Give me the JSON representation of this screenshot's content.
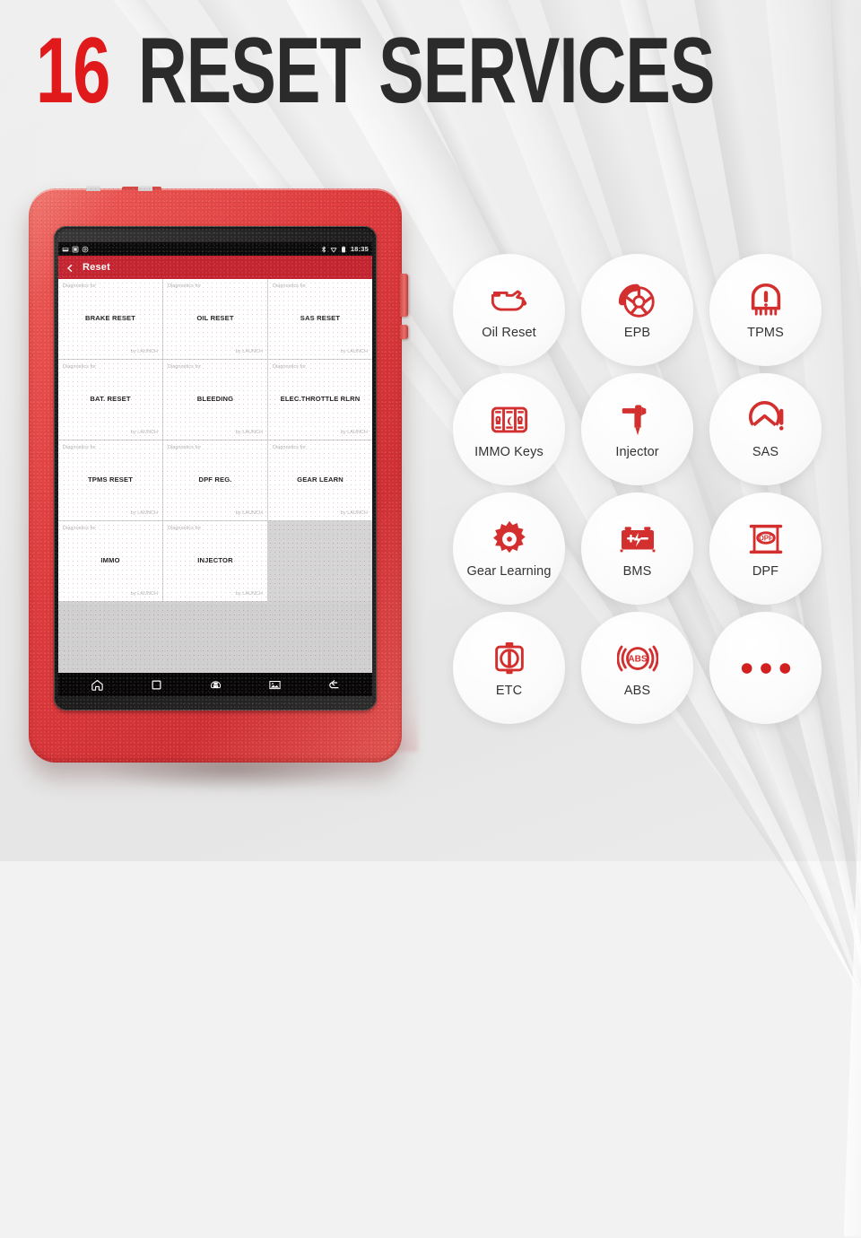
{
  "headline": {
    "number": "16",
    "text": "RESET SERVICES",
    "number_color": "#e0191b",
    "text_color": "#2b2b2b"
  },
  "device": {
    "name": "launch-diagnostic-tablet",
    "case_color": "#d9383b",
    "bezel_color": "#1a1a1a"
  },
  "status_bar": {
    "clock": "18:35",
    "left_icons": [
      "sdcard-icon",
      "screenshot-icon",
      "settings-icon"
    ],
    "right_icons": [
      "bluetooth-icon",
      "wifi-icon",
      "battery-icon"
    ]
  },
  "app_header": {
    "back_icon": "chevron-left-icon",
    "title": "Reset",
    "color": "#c3242f"
  },
  "reset_grid": {
    "subtitle_label": "Diagnostics for",
    "vendor_label": "by LAUNCH",
    "items": [
      {
        "title": "BRAKE RESET"
      },
      {
        "title": "OIL RESET"
      },
      {
        "title": "SAS RESET"
      },
      {
        "title": "BAT. RESET"
      },
      {
        "title": "BLEEDING"
      },
      {
        "title": "ELEC.THROTTLE RLRN"
      },
      {
        "title": "TPMS RESET"
      },
      {
        "title": "DPF REG."
      },
      {
        "title": "GEAR LEARN"
      },
      {
        "title": "IMMO"
      },
      {
        "title": "INJECTOR"
      }
    ]
  },
  "nav_bar": {
    "buttons": [
      {
        "name": "home-icon"
      },
      {
        "name": "recents-square-icon"
      },
      {
        "name": "vci-connector-icon"
      },
      {
        "name": "screenshot-image-icon"
      },
      {
        "name": "back-arrow-icon"
      }
    ]
  },
  "features": {
    "accent_color": "#d32f2f",
    "items": [
      {
        "label": "Oil Reset",
        "icon": "oil-can-icon"
      },
      {
        "label": "EPB",
        "icon": "brake-wheel-icon"
      },
      {
        "label": "TPMS",
        "icon": "tire-pressure-icon"
      },
      {
        "label": "IMMO Keys",
        "icon": "immo-keys-icon"
      },
      {
        "label": "Injector",
        "icon": "injector-icon"
      },
      {
        "label": "SAS",
        "icon": "steering-angle-icon"
      },
      {
        "label": "Gear Learning",
        "icon": "gear-icon"
      },
      {
        "label": "BMS",
        "icon": "battery-bms-icon"
      },
      {
        "label": "DPF",
        "icon": "dpf-filter-icon"
      },
      {
        "label": "ETC",
        "icon": "throttle-body-icon"
      },
      {
        "label": "ABS",
        "icon": "abs-icon"
      },
      {
        "label": "",
        "icon": "more-dots-icon"
      }
    ]
  }
}
